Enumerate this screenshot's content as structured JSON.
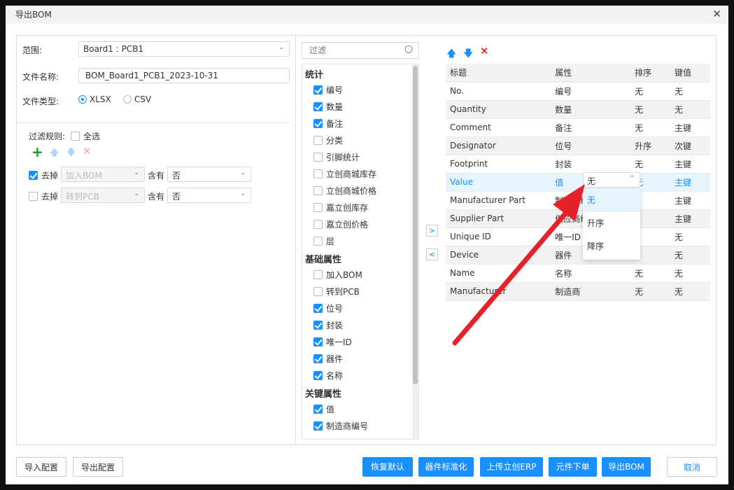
{
  "dialog": {
    "title": "导出BOM"
  },
  "form": {
    "scope_label": "范围:",
    "scope_value": "Board1 : PCB1",
    "filename_label": "文件名称:",
    "filename_value": "BOM_Board1_PCB1_2023-10-31",
    "filetype_label": "文件类型:",
    "types": [
      {
        "label": "XLSX",
        "selected": true
      },
      {
        "label": "CSV",
        "selected": false
      }
    ]
  },
  "filter": {
    "label": "过滤规则:",
    "select_all": "全选",
    "rules": [
      {
        "checked": true,
        "remove": "去掉",
        "field": "加入BOM",
        "contains": "含有",
        "value": "否"
      },
      {
        "checked": false,
        "remove": "去掉",
        "field": "转到PCB",
        "contains": "含有",
        "value": "否"
      }
    ]
  },
  "search": {
    "placeholder": "过滤"
  },
  "groups": [
    {
      "title": "统计",
      "items": [
        {
          "label": "编号",
          "checked": true
        },
        {
          "label": "数量",
          "checked": true
        },
        {
          "label": "备注",
          "checked": true
        },
        {
          "label": "分类",
          "checked": false
        },
        {
          "label": "引脚统计",
          "checked": false
        },
        {
          "label": "立创商城库存",
          "checked": false
        },
        {
          "label": "立创商城价格",
          "checked": false
        },
        {
          "label": "嘉立创库存",
          "checked": false
        },
        {
          "label": "嘉立创价格",
          "checked": false
        },
        {
          "label": "层",
          "checked": false
        }
      ]
    },
    {
      "title": "基础属性",
      "items": [
        {
          "label": "加入BOM",
          "checked": false
        },
        {
          "label": "转到PCB",
          "checked": false
        },
        {
          "label": "位号",
          "checked": true
        },
        {
          "label": "封装",
          "checked": true
        },
        {
          "label": "唯一ID",
          "checked": true
        },
        {
          "label": "器件",
          "checked": true
        },
        {
          "label": "名称",
          "checked": true
        }
      ]
    },
    {
      "title": "关键属性",
      "items": [
        {
          "label": "值",
          "checked": true
        },
        {
          "label": "制造商编号",
          "checked": true
        }
      ]
    }
  ],
  "table": {
    "headers": [
      "标题",
      "属性",
      "排序",
      "键值"
    ],
    "rows": [
      [
        "No.",
        "编号",
        "无",
        "无"
      ],
      [
        "Quantity",
        "数量",
        "无",
        "无"
      ],
      [
        "Comment",
        "备注",
        "无",
        "主键"
      ],
      [
        "Designator",
        "位号",
        "升序",
        "次键"
      ],
      [
        "Footprint",
        "封装",
        "无",
        "主键"
      ],
      [
        "Value",
        "值",
        "无",
        "主键"
      ],
      [
        "Manufacturer Part",
        "制造商编号",
        "",
        "主键"
      ],
      [
        "Supplier Part",
        "供应商编号",
        "",
        "主键"
      ],
      [
        "Unique ID",
        "唯一ID",
        "",
        "无"
      ],
      [
        "Device",
        "器件",
        "",
        "无"
      ],
      [
        "Name",
        "名称",
        "无",
        "无"
      ],
      [
        "Manufacturer",
        "制造商",
        "无",
        "无"
      ]
    ],
    "selected_row": 5
  },
  "sort_dropdown": {
    "value": "无",
    "options": [
      "无",
      "升序",
      "降序"
    ],
    "highlighted": "无"
  },
  "buttons": {
    "import": "导入配置",
    "export_config": "导出配置",
    "restore": "恢复默认",
    "standardize": "器件标准化",
    "upload_erp": "上传立创ERP",
    "order": "元件下单",
    "export_bom": "导出BOM",
    "cancel": "取消"
  },
  "colors": {
    "accent": "#1890ff",
    "annotation_arrow": "#e8202a"
  }
}
